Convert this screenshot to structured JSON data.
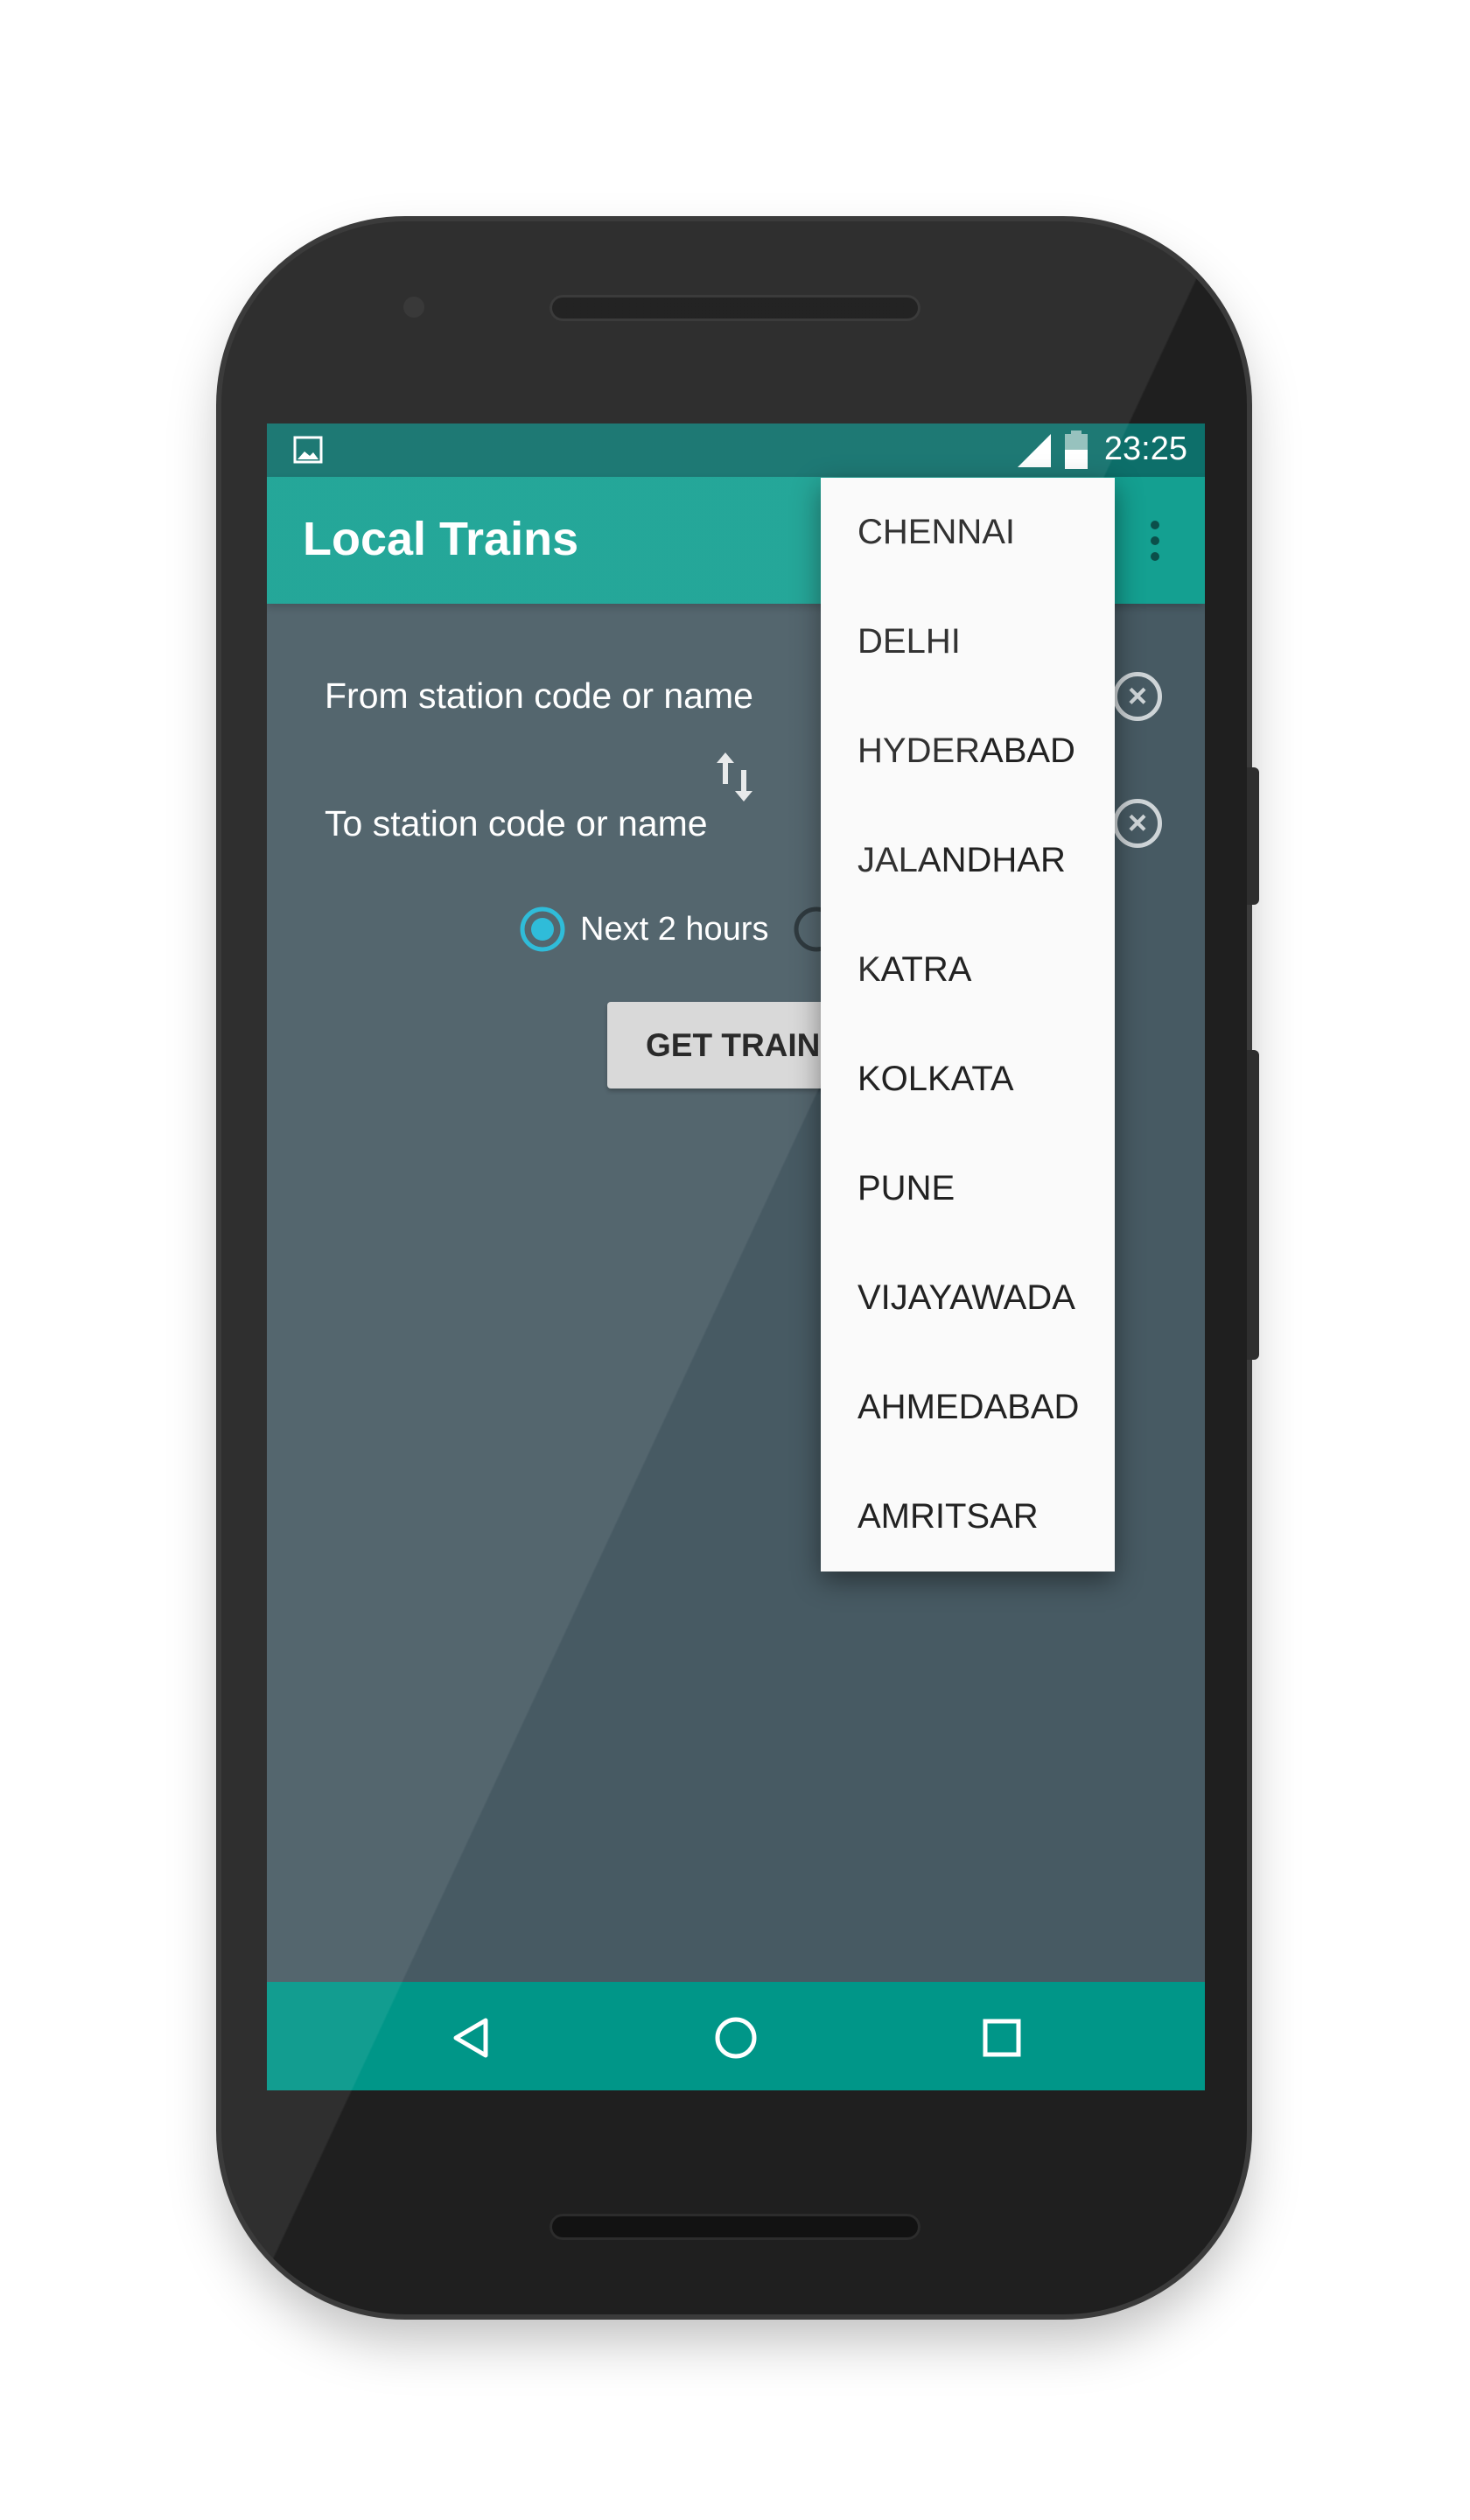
{
  "status_bar": {
    "time": "23:25",
    "icons": [
      "image-icon",
      "signal-icon",
      "battery-icon"
    ]
  },
  "app_bar": {
    "title": "Local Trains",
    "menu_icon": "overflow-menu-icon"
  },
  "form": {
    "from_placeholder": "From station code or name",
    "to_placeholder": "To station code or name",
    "swap_icon": "swap-vertical-icon",
    "clear_icon": "clear-circle-icon",
    "radio_options": [
      {
        "label": "Next 2 hours",
        "selected": true
      },
      {
        "label": "",
        "selected": false
      }
    ],
    "get_trains_label": "GET TRAINS"
  },
  "dropdown": {
    "items": [
      "CHENNAI",
      "DELHI",
      "HYDERABAD",
      "JALANDHAR",
      "KATRA",
      "KOLKATA",
      "PUNE",
      "VIJAYAWADA",
      "AHMEDABAD",
      "AMRITSAR"
    ]
  },
  "nav_bar": {
    "icons": [
      "back-icon",
      "home-icon",
      "recents-icon"
    ]
  },
  "colors": {
    "app_bar": "#14a091",
    "status_bar": "#0d6f6a",
    "background": "#475a63",
    "nav_bar": "#009688",
    "accent": "#1fb7d6"
  }
}
